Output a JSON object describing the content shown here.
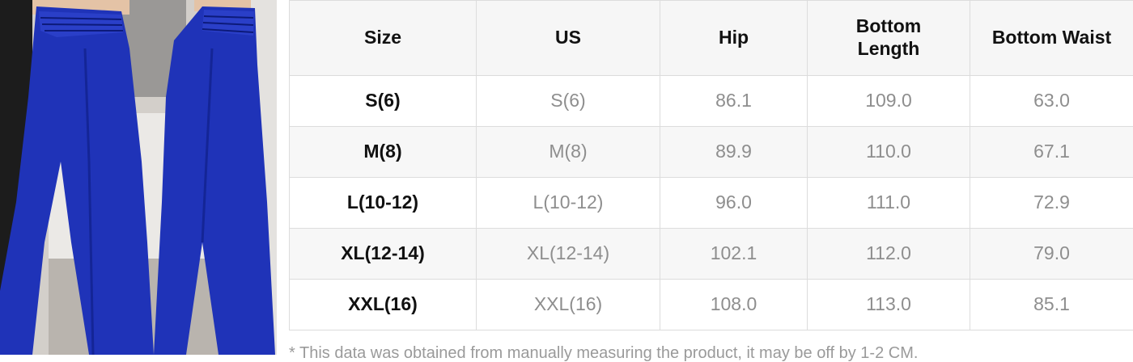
{
  "table": {
    "headers": [
      "Size",
      "US",
      "Hip",
      "Bottom\nLength",
      "Bottom Waist"
    ],
    "rows": [
      [
        "S(6)",
        "S(6)",
        "86.1",
        "109.0",
        "63.0"
      ],
      [
        "M(8)",
        "M(8)",
        "89.9",
        "110.0",
        "67.1"
      ],
      [
        "L(10-12)",
        "L(10-12)",
        "96.0",
        "111.0",
        "72.9"
      ],
      [
        "XL(12-14)",
        "XL(12-14)",
        "102.1",
        "112.0",
        "79.0"
      ],
      [
        "XXL(16)",
        "XXL(16)",
        "108.0",
        "113.0",
        "85.1"
      ]
    ]
  },
  "note": "* This data was obtained from manually measuring the product, it may be off by 1-2 CM.",
  "colors": {
    "pants": "#1f33b8",
    "header_bg": "#f6f6f6",
    "border": "#dcdcdc",
    "value_text": "#8e8e8e"
  }
}
